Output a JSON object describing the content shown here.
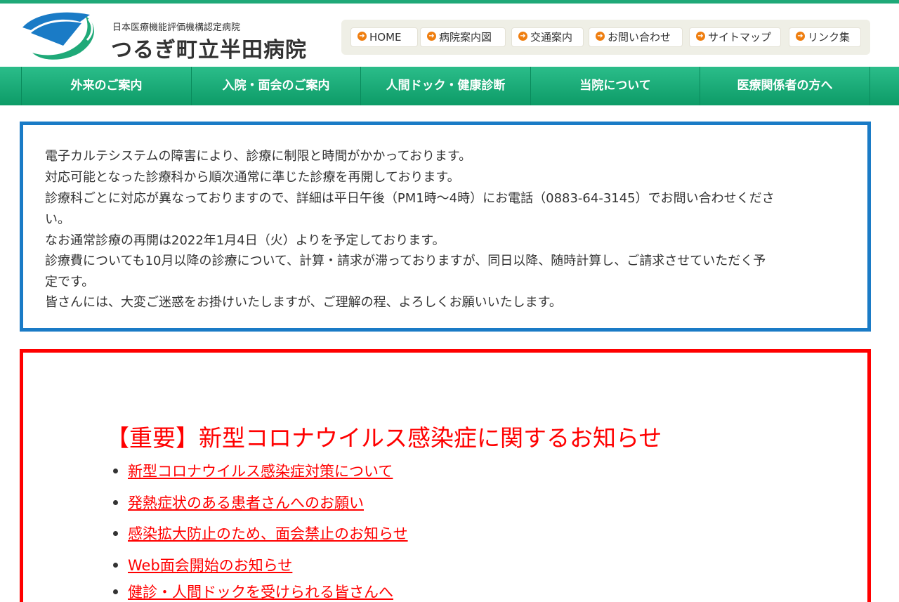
{
  "colors": {
    "accent_green": "#1fa978",
    "nav_green": "#0d9b67",
    "notice_blue": "#1a7bc6",
    "alert_red": "#ff0000",
    "bullet_orange": "#ef7e0f"
  },
  "header": {
    "logo_subtitle": "日本医療機能評価機構認定病院",
    "logo_title": "つるぎ町立半田病院",
    "utility_links": [
      {
        "label": "HOME",
        "icon": "orange-arrow-icon"
      },
      {
        "label": "病院案内図",
        "icon": "orange-arrow-icon"
      },
      {
        "label": "交通案内",
        "icon": "orange-arrow-icon"
      },
      {
        "label": "お問い合わせ",
        "icon": "orange-arrow-icon"
      },
      {
        "label": "サイトマップ",
        "icon": "orange-arrow-icon"
      },
      {
        "label": "リンク集",
        "icon": "orange-arrow-icon"
      }
    ]
  },
  "nav": {
    "items": [
      {
        "label": "外来のご案内"
      },
      {
        "label": "入院・面会のご案内"
      },
      {
        "label": "人間ドック・健康診断"
      },
      {
        "label": "当院について"
      },
      {
        "label": "医療関係者の方へ"
      }
    ]
  },
  "notice": {
    "lines": [
      "電子カルテシステムの障害により、診療に制限と時間がかかっております。",
      "対応可能となった診療科から順次通常に準じた診療を再開しております。",
      "診療科ごとに対応が異なっておりますので、詳細は平日午後（PM1時～4時）にお電話（0883-64-3145）でお問い合わせくださ",
      "い。",
      "なお通常診療の再開は2022年1月4日（火）よりを予定しております。",
      "診療費についても10月以降の診療について、計算・請求が滞っておりますが、同日以降、随時計算し、ご請求させていただく予",
      "定です。",
      "皆さんには、大変ご迷惑をお掛けいたしますが、ご理解の程、よろしくお願いいたします。"
    ]
  },
  "covid": {
    "title": "【重要】新型コロナウイルス感染症に関するお知らせ",
    "links": [
      {
        "label": "新型コロナウイルス感染症対策について"
      },
      {
        "label": "発熱症状のある患者さんへのお願い"
      },
      {
        "label": "感染拡大防止のため、面会禁止のお知らせ"
      },
      {
        "label": "Web面会開始のお知らせ"
      },
      {
        "label": "健診・人間ドックを受けられる皆さんへ"
      }
    ]
  }
}
